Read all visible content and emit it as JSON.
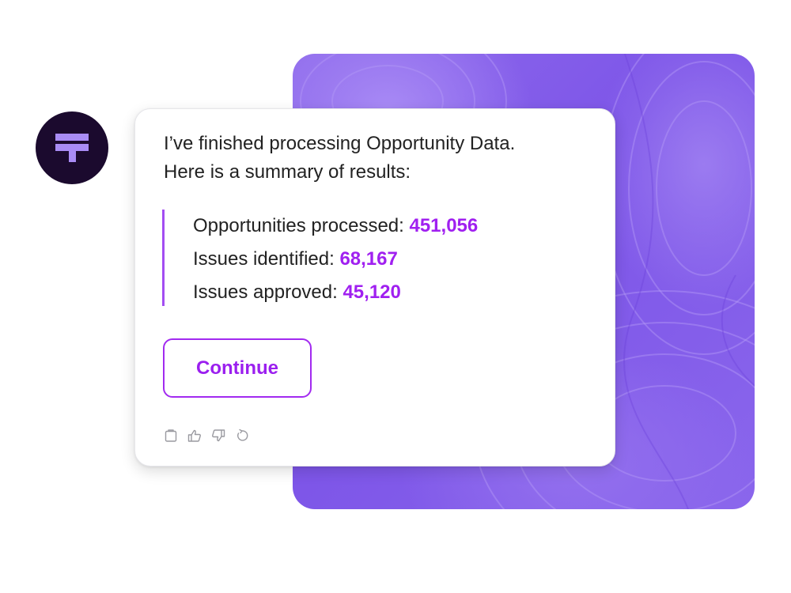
{
  "message": {
    "line1": "I’ve finished processing Opportunity Data.",
    "line2": "Here is a summary of results:"
  },
  "summary": [
    {
      "label": "Opportunities processed: ",
      "value": "451,056"
    },
    {
      "label": "Issues identified: ",
      "value": "68,167"
    },
    {
      "label": "Issues approved: ",
      "value": "45,120"
    }
  ],
  "continue_button": {
    "label": "Continue"
  },
  "actions": [
    "copy-icon",
    "thumbs-up-icon",
    "thumbs-down-icon",
    "regenerate-icon"
  ],
  "colors": {
    "accent": "#a020f0",
    "background_panel": "#8460ea",
    "avatar_bg": "#1b0a2e",
    "logo": "#a98cf5"
  }
}
